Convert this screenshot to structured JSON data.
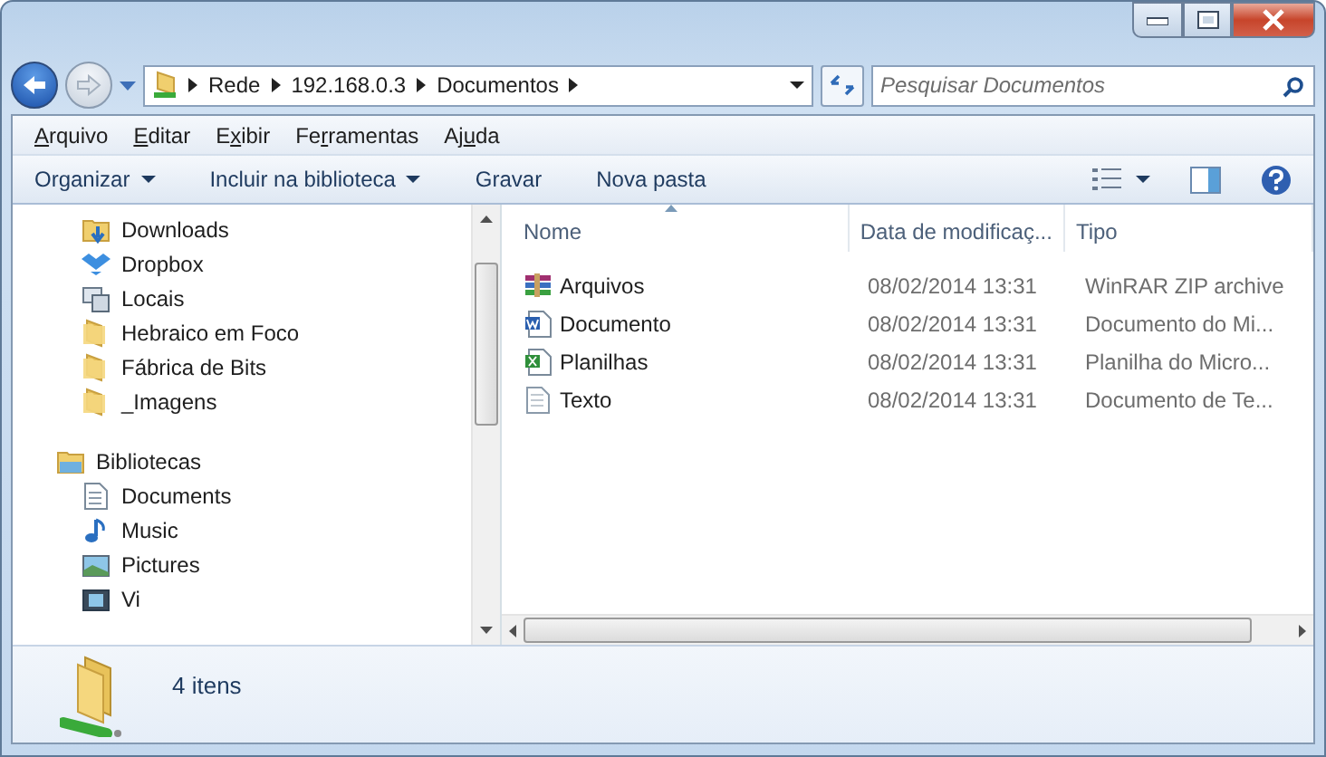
{
  "address": {
    "breadcrumb": [
      "Rede",
      "192.168.0.3",
      "Documentos"
    ]
  },
  "search": {
    "placeholder": "Pesquisar Documentos"
  },
  "menu": [
    {
      "key": "A",
      "after": "rquivo"
    },
    {
      "key": "E",
      "after": "ditar"
    },
    {
      "before": "E",
      "key": "x",
      "after": "ibir"
    },
    {
      "before": "Fe",
      "key": "r",
      "after": "ramentas"
    },
    {
      "before": "Aj",
      "key": "u",
      "after": "da"
    }
  ],
  "toolbar": [
    {
      "label": "Organizar",
      "dropdown": true
    },
    {
      "label": "Incluir na biblioteca",
      "dropdown": true
    },
    {
      "label": "Gravar",
      "dropdown": false
    },
    {
      "label": "Nova pasta",
      "dropdown": false
    }
  ],
  "sidebar": {
    "items": [
      {
        "label": "Downloads",
        "kind": "downloads"
      },
      {
        "label": "Dropbox",
        "kind": "dropbox"
      },
      {
        "label": "Locais",
        "kind": "computer"
      },
      {
        "label": "Hebraico em Foco",
        "kind": "folder"
      },
      {
        "label": "Fábrica de Bits",
        "kind": "folder"
      },
      {
        "label": "_Imagens",
        "kind": "folder"
      },
      {
        "label": "Bibliotecas",
        "kind": "library",
        "children": [
          {
            "label": "Documents",
            "kind": "document"
          },
          {
            "label": "Music",
            "kind": "music"
          },
          {
            "label": "Pictures",
            "kind": "picture"
          },
          {
            "label": "Vi",
            "kind": "video"
          }
        ]
      }
    ]
  },
  "table": {
    "columns": [
      {
        "label": "Nome",
        "sorted": true
      },
      {
        "label": "Data de modificaç...",
        "sorted": false
      },
      {
        "label": "Tipo",
        "sorted": false
      }
    ],
    "rows": [
      {
        "kind": "archive",
        "name": "Arquivos",
        "date": "08/02/2014 13:31",
        "type": "WinRAR ZIP archive"
      },
      {
        "kind": "word",
        "name": "Documento",
        "date": "08/02/2014 13:31",
        "type": "Documento do Mi..."
      },
      {
        "kind": "excel",
        "name": "Planilhas",
        "date": "08/02/2014 13:31",
        "type": "Planilha do Micro..."
      },
      {
        "kind": "text",
        "name": "Texto",
        "date": "08/02/2014 13:31",
        "type": "Documento de Te..."
      }
    ]
  },
  "status_bar": {
    "count": "4 itens"
  }
}
